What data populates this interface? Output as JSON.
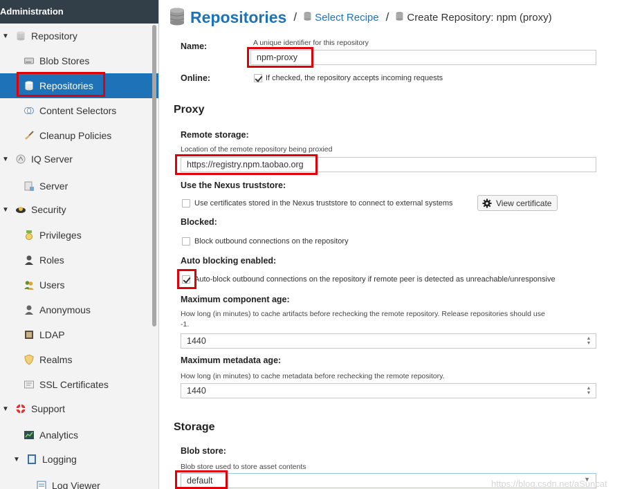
{
  "sidebar": {
    "header": "Administration",
    "items": [
      {
        "label": "Repository",
        "icon": "database-icon"
      },
      {
        "label": "Blob Stores",
        "icon": "hard-drive-icon"
      },
      {
        "label": "Repositories",
        "icon": "database-icon"
      },
      {
        "label": "Content Selectors",
        "icon": "content-selector-icon"
      },
      {
        "label": "Cleanup Policies",
        "icon": "broom-icon"
      },
      {
        "label": "IQ Server",
        "icon": "iq-icon"
      },
      {
        "label": "Server",
        "icon": "server-icon"
      },
      {
        "label": "Security",
        "icon": "security-icon"
      },
      {
        "label": "Privileges",
        "icon": "medal-icon"
      },
      {
        "label": "Roles",
        "icon": "user-role-icon"
      },
      {
        "label": "Users",
        "icon": "users-icon"
      },
      {
        "label": "Anonymous",
        "icon": "anonymous-user-icon"
      },
      {
        "label": "LDAP",
        "icon": "ldap-book-icon"
      },
      {
        "label": "Realms",
        "icon": "shield-icon"
      },
      {
        "label": "SSL Certificates",
        "icon": "certificate-icon"
      },
      {
        "label": "Support",
        "icon": "lifebuoy-icon"
      },
      {
        "label": "Analytics",
        "icon": "analytics-icon"
      },
      {
        "label": "Logging",
        "icon": "log-icon"
      },
      {
        "label": "Log Viewer",
        "icon": "log-viewer-icon"
      }
    ]
  },
  "breadcrumb": {
    "title": "Repositories",
    "separator": "/",
    "recipe": "Select Recipe",
    "current": "Create Repository: npm (proxy)"
  },
  "form": {
    "name_label": "Name:",
    "name_help": "A unique identifier for this repository",
    "name_value": "npm-proxy",
    "online_label": "Online:",
    "online_text": "If checked, the repository accepts incoming requests",
    "online_checked": true,
    "proxy_section": "Proxy",
    "remote_label": "Remote storage:",
    "remote_help": "Location of the remote repository being proxied",
    "remote_value": "https://registry.npm.taobao.org",
    "truststore_label": "Use the Nexus truststore:",
    "truststore_text": "Use certificates stored in the Nexus truststore to connect to external systems",
    "truststore_checked": false,
    "view_cert_label": "View certificate",
    "blocked_label": "Blocked:",
    "blocked_text": "Block outbound connections on the repository",
    "blocked_checked": false,
    "autoblock_label": "Auto blocking enabled:",
    "autoblock_text": "Auto-block outbound connections on the repository if remote peer is detected as unreachable/unresponsive",
    "autoblock_checked": true,
    "max_comp_label": "Maximum component age:",
    "max_comp_help_1": "How long (in minutes) to cache artifacts before rechecking the remote repository. Release repositories should use",
    "max_comp_help_2": "-1.",
    "max_comp_value": "1440",
    "max_meta_label": "Maximum metadata age:",
    "max_meta_help": "How long (in minutes) to cache metadata before rechecking the remote repository.",
    "max_meta_value": "1440",
    "storage_section": "Storage",
    "blob_label": "Blob store:",
    "blob_help": "Blob store used to store asset contents",
    "blob_value": "default"
  },
  "colors": {
    "accent": "#1d72b8",
    "highlight_box": "#e0000a",
    "sidebar_header": "#323e48"
  },
  "watermark": "https://blog.csdn.net/aSuncat"
}
